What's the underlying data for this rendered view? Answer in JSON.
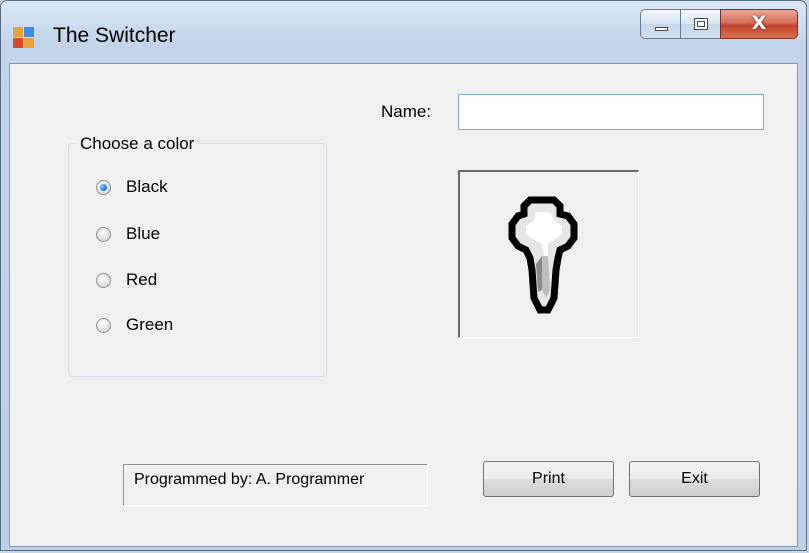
{
  "window": {
    "title": "The Switcher",
    "controls": {
      "minimize": "minimize",
      "maximize": "maximize",
      "close": "X"
    }
  },
  "form": {
    "name_label": "Name:",
    "name_value": "",
    "group": {
      "title": "Choose a color",
      "options": [
        {
          "label": "Black",
          "checked": true
        },
        {
          "label": "Blue",
          "checked": false
        },
        {
          "label": "Red",
          "checked": false
        },
        {
          "label": "Green",
          "checked": false
        }
      ]
    },
    "picture": {
      "icon": "lightbulb-icon"
    },
    "credit_text": "Programmed by: A. Programmer",
    "print_label": "Print",
    "exit_label": "Exit"
  },
  "colors": {
    "radio_selected": "#1c6fc2",
    "close_button": "#c2452c",
    "input_border": "#7aa7d6"
  }
}
